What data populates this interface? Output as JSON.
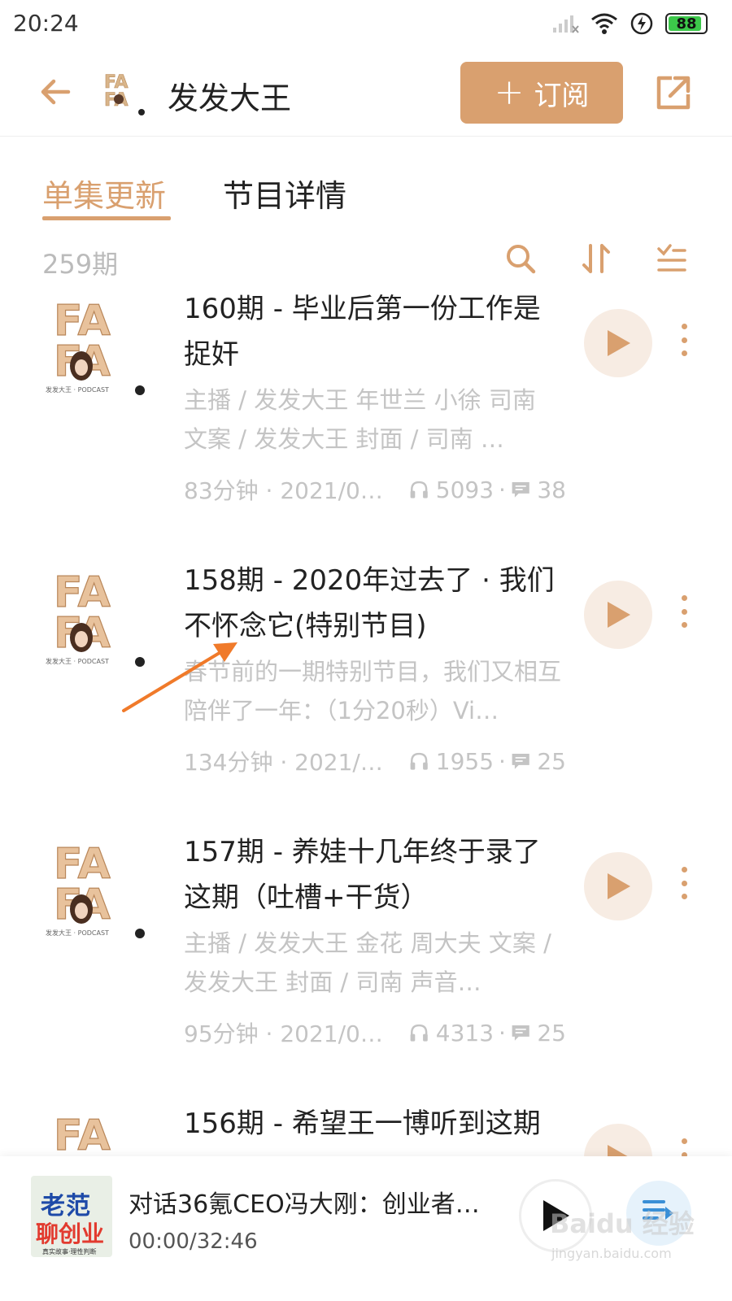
{
  "status_bar": {
    "time": "20:24",
    "battery": "88"
  },
  "header": {
    "title": "发发大王",
    "subscribe_label": "订阅"
  },
  "tabs": [
    {
      "label": "单集更新"
    },
    {
      "label": "节目详情"
    }
  ],
  "toolbar": {
    "count": "259期"
  },
  "episodes": [
    {
      "title": "160期 - 毕业后第一份工作是捉奸",
      "desc": "主播 / 发发大王 年世兰 小徐 司南 文案 / 发发大王 封面 / 司南 …",
      "duration_date": "83分钟 · 2021/0…",
      "plays": "5093",
      "comments": "38"
    },
    {
      "title": "158期 - 2020年过去了 · 我们不怀念它(特别节目)",
      "desc": "春节前的一期特别节目，我们又相互陪伴了一年：（1分20秒）Vi…",
      "duration_date": "134分钟 · 2021/…",
      "plays": "1955",
      "comments": "25"
    },
    {
      "title": "157期 - 养娃十几年终于录了这期（吐槽+干货）",
      "desc": "主播 / 发发大王 金花 周大夫 文案 / 发发大王 封面 / 司南 声音…",
      "duration_date": "95分钟 · 2021/0…",
      "plays": "4313",
      "comments": "25"
    },
    {
      "title": "156期 - 希望王一博听到这期",
      "desc": "",
      "duration_date": "",
      "plays": "",
      "comments": ""
    }
  ],
  "cover": {
    "line1": "FA",
    "line2": "FA",
    "caption": "发发大王 · PODCAST"
  },
  "player": {
    "title": "对话36氪CEO冯大刚：创业者…",
    "time": "00:00/32:46",
    "cover_line1": "老范",
    "cover_line2": "聊创业",
    "cover_line3": "真实故事·理性判断"
  },
  "watermark": {
    "text": "Baidu 经验",
    "sub": "jingyan.baidu.com"
  },
  "colors": {
    "accent": "#d9a06f",
    "muted_text": "#c4c4c4",
    "annotation": "#f07a2a"
  },
  "icons": [
    "back-arrow-icon",
    "share-icon",
    "search-icon",
    "sort-icon",
    "filter-list-icon",
    "play-icon",
    "more-vertical-icon",
    "headphones-icon",
    "comment-icon",
    "playlist-icon",
    "wifi-icon",
    "signal-icon",
    "charging-icon"
  ]
}
